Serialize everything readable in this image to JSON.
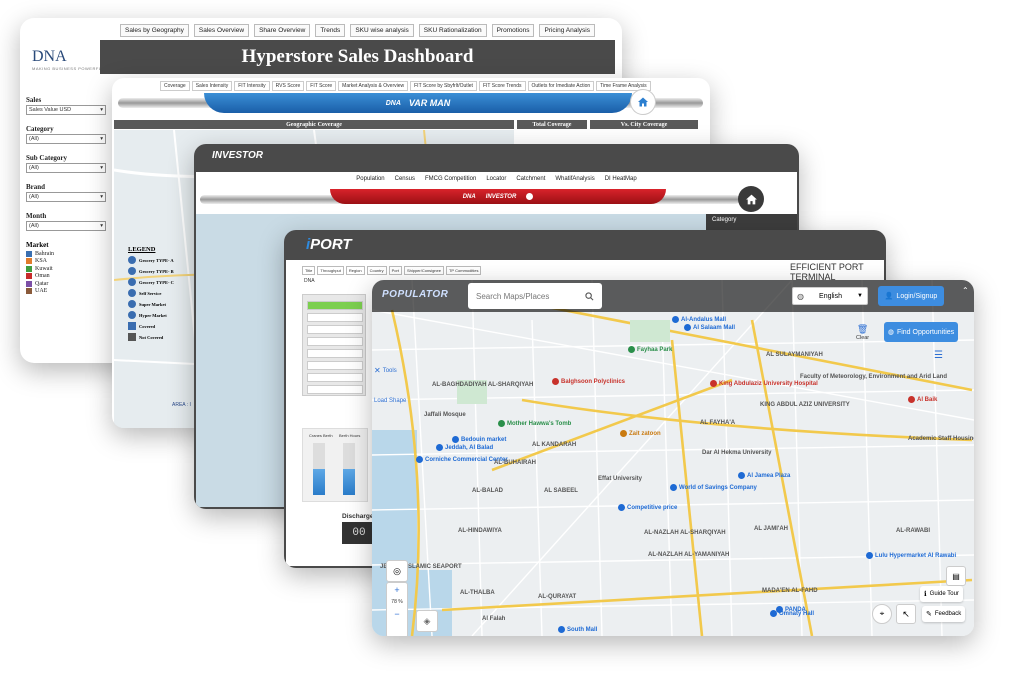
{
  "hyperstore": {
    "tabs": [
      "Sales by Geography",
      "Sales Overview",
      "Share Overview",
      "Trends",
      "SKU wise analysis",
      "SKU Rationalization",
      "Promotions",
      "Pricing Analysis"
    ],
    "logo": "DNA",
    "logo_tagline": "MAKING BUSINESS POWERFUL",
    "title": "Hyperstore Sales Dashboard",
    "filters": [
      {
        "label": "Sales",
        "value": "Sales Value USD"
      },
      {
        "label": "Category",
        "value": "(All)"
      },
      {
        "label": "Sub Category",
        "value": "(All)"
      },
      {
        "label": "Brand",
        "value": "(All)"
      },
      {
        "label": "Month",
        "value": "(All)"
      }
    ],
    "market_label": "Market",
    "markets": [
      {
        "name": "Bahrain",
        "color": "#3a6fb0"
      },
      {
        "name": "KSA",
        "color": "#e07b2b"
      },
      {
        "name": "Kuwait",
        "color": "#3f9c3f"
      },
      {
        "name": "Oman",
        "color": "#c72b2b"
      },
      {
        "name": "Qatar",
        "color": "#7c4fa6"
      },
      {
        "name": "UAE",
        "color": "#8a5a3a"
      }
    ]
  },
  "dna": {
    "nav": [
      "Coverage",
      "Sales Intensity",
      "FIT Intensity",
      "RVS Score",
      "FIT Score",
      "Market Analysis & Overview",
      "FIT Score by Sbyfrlt/Outlet",
      "FIT Score Trends",
      "Outlets for Imediate Action",
      "Time Frame Analysis"
    ],
    "logo_left": "DNA",
    "logo_right": "VAR MAN",
    "section_geo": "Geographic Coverage",
    "section_total": "Total Coverage",
    "section_city": "Vs. City Coverage",
    "legend_title": "LEGEND",
    "legend": [
      "Grocery TYPE- A",
      "Grocery TYPE- B",
      "Grocery TYPE- C",
      "Self Service",
      "Super Market",
      "Hyper Market",
      "Covered",
      "Not Covered"
    ],
    "area_label": "AREA : I"
  },
  "investor": {
    "logo": "INVESTOR",
    "menu": [
      "Population",
      "Census",
      "FMCG Competition",
      "Locator",
      "Catchment",
      "WhatifAnalysis",
      "DI HeatMap"
    ],
    "strip_left": "DNA",
    "strip_right": "INVESTOR",
    "side_label": "Category"
  },
  "port": {
    "logo_prefix": "i",
    "logo_main": "PORT",
    "tagline": "EFFICIENT PORT TERMINAL",
    "tabs": [
      "Title",
      "Throughput",
      "Region",
      "Country",
      "Port",
      "Shipper/Consignee",
      "TP Commodities"
    ],
    "crumb": "DNA",
    "gauge_labels": [
      "Cranes Berth",
      "Berth Hours"
    ],
    "discharge_label": "Discharge",
    "discharge_display": "00"
  },
  "populator": {
    "logo": "POPULATOR",
    "search_placeholder": "Search Maps/Places",
    "language": "English",
    "login": "Login/Signup",
    "find": "Find Opportunities",
    "close": "Clear",
    "tools": "Tools",
    "load_shape": "Load Shape",
    "zoom": "78 %",
    "guide": "Guide Tour",
    "feedback": "Feedback",
    "places": [
      {
        "t": "Al Salaam Mall",
        "c": "b"
      },
      {
        "t": "Fayhaa Park",
        "c": "g"
      },
      {
        "t": "Balghsoon Polyclinics",
        "c": "r"
      },
      {
        "t": "King Abdulaziz University Hospital",
        "c": "r"
      },
      {
        "t": "AL-BAGHDADIYAH AL-SHARQIYAH",
        "c": "d"
      },
      {
        "t": "Jaffali Mosque",
        "c": "d"
      },
      {
        "t": "Mother Hawwa's Tomb",
        "c": "g"
      },
      {
        "t": "Bedouin market",
        "c": "b"
      },
      {
        "t": "Jeddah, Al Balad",
        "c": "b"
      },
      {
        "t": "Corniche Commercial Center",
        "c": "b"
      },
      {
        "t": "AL KANDARAH",
        "c": "d"
      },
      {
        "t": "AL-BUHAIRAH",
        "c": "d"
      },
      {
        "t": "Zait zatoon",
        "c": "o"
      },
      {
        "t": "AL FAYHA'A",
        "c": "d"
      },
      {
        "t": "Dar Al Hekma University",
        "c": "d"
      },
      {
        "t": "Effat University",
        "c": "d"
      },
      {
        "t": "World of Savings Company",
        "c": "b"
      },
      {
        "t": "Al Jamea Plaza",
        "c": "b"
      },
      {
        "t": "Competitive price",
        "c": "b"
      },
      {
        "t": "AL-BALAD",
        "c": "d"
      },
      {
        "t": "AL SABEEL",
        "c": "d"
      },
      {
        "t": "AL-HINDAWIYA",
        "c": "d"
      },
      {
        "t": "AL-NAZLAH AL-SHARQIYAH",
        "c": "d"
      },
      {
        "t": "AL-NAZLAH AL-YAMANIYAH",
        "c": "d"
      },
      {
        "t": "AL JAMI'AH",
        "c": "d"
      },
      {
        "t": "AL-RAWABI",
        "c": "d"
      },
      {
        "t": "Lulu Hypermarket Al Rawabi",
        "c": "b"
      },
      {
        "t": "Academic Staff Housing",
        "c": "d"
      },
      {
        "t": "MADA'EN AL-FAHD",
        "c": "d"
      },
      {
        "t": "Omnaty Hall",
        "c": "b"
      },
      {
        "t": "PANDA",
        "c": "b"
      },
      {
        "t": "AL-THALBA",
        "c": "d"
      },
      {
        "t": "AL-QURAYAT",
        "c": "d"
      },
      {
        "t": "JEDDAH ISLAMIC SEAPORT",
        "c": "d"
      },
      {
        "t": "Al Falah",
        "c": "d"
      },
      {
        "t": "South Mall",
        "c": "b"
      },
      {
        "t": "Al Baik",
        "c": "r"
      },
      {
        "t": "AL SULAYMANIYAH",
        "c": "d"
      },
      {
        "t": "Faculty of Meteorology, Environment and Arid Land",
        "c": "d"
      },
      {
        "t": "KING ABDUL AZIZ UNIVERSITY",
        "c": "d"
      },
      {
        "t": "Al-Andalus Mall",
        "c": "b"
      }
    ]
  }
}
